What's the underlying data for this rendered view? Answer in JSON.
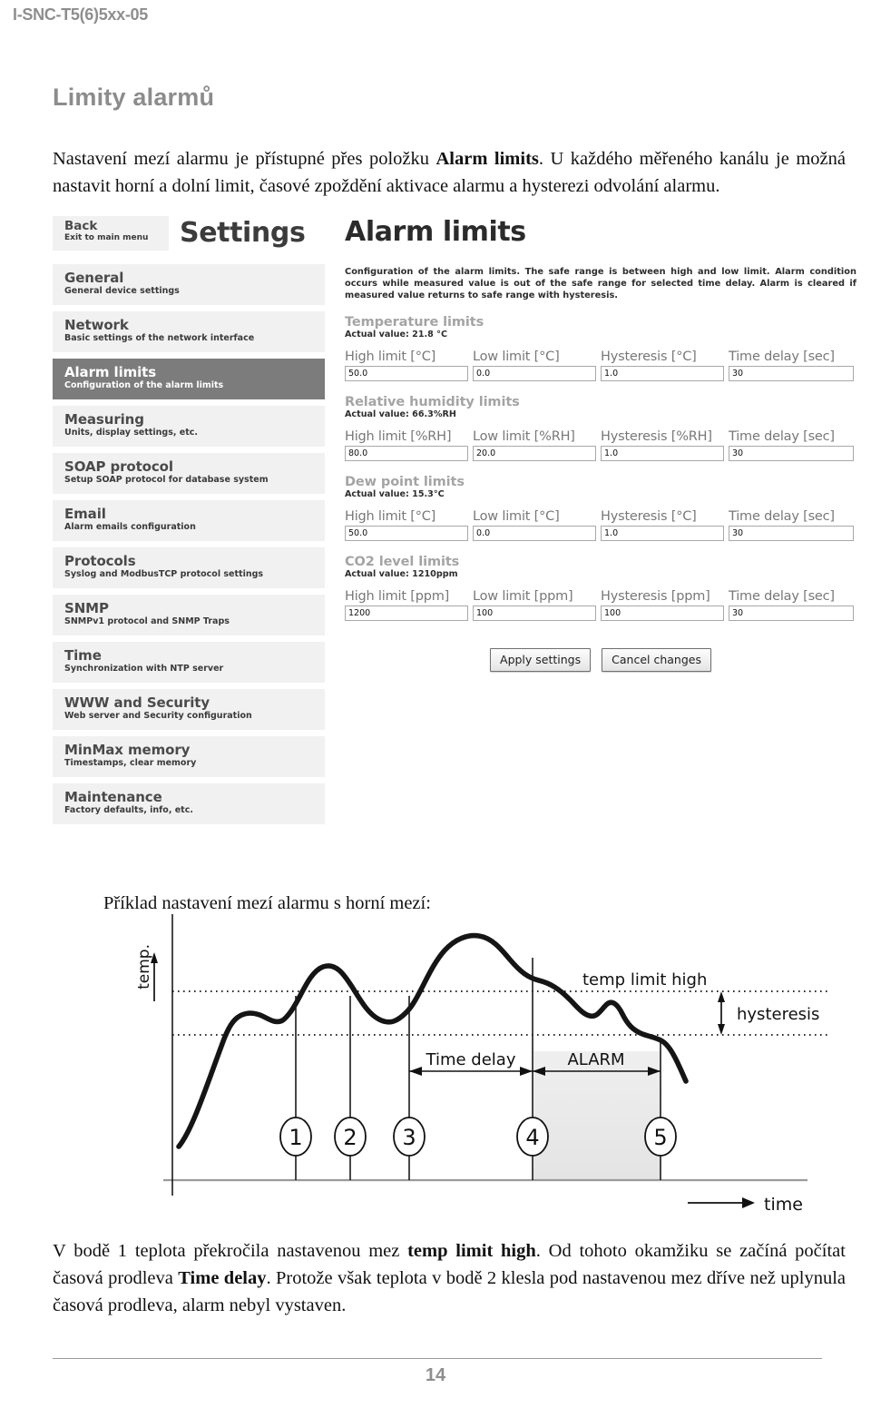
{
  "doc": {
    "running_header": "I-SNC-T5(6)5xx-05",
    "page_number": "14",
    "section_title": "Limity alarmů",
    "intro_para_1": "Nastavení mezí alarmu je přístupné přes položku ",
    "intro_bold_1": "Alarm limits",
    "intro_para_2": ". U každého měřeného kanálu je možná nastavit horní a dolní limit, časové zpoždění aktivace alarmu a hysterezi odvolání alarmu.",
    "example_caption": "Příklad nastavení mezí alarmu s horní mezí:",
    "closing_1": "V bodě 1 teplota překročila nastavenou mez ",
    "closing_bold_1": "temp limit high",
    "closing_2": ". Od tohoto okamžiku se začíná počítat časová prodleva ",
    "closing_bold_2": "Time delay",
    "closing_3": ". Protože však teplota v bodě 2 klesla pod nastavenou mez dříve než uplynula časová prodleva, alarm nebyl vystaven."
  },
  "screenshot": {
    "back": {
      "title": "Back",
      "subtitle": "Exit to main menu"
    },
    "settings_heading": "Settings",
    "page_heading": "Alarm limits",
    "description": "Configuration of the alarm limits. The safe range is between high and low limit. Alarm condition occurs while measured value is out of the safe range for selected time delay. Alarm is cleared if measured value returns to safe range with hysteresis.",
    "nav": [
      {
        "title": "General",
        "subtitle": "General device settings",
        "active": false
      },
      {
        "title": "Network",
        "subtitle": "Basic settings of the network interface",
        "active": false
      },
      {
        "title": "Alarm limits",
        "subtitle": "Configuration of the alarm limits",
        "active": true
      },
      {
        "title": "Measuring",
        "subtitle": "Units, display settings, etc.",
        "active": false
      },
      {
        "title": "SOAP protocol",
        "subtitle": "Setup SOAP protocol for database system",
        "active": false
      },
      {
        "title": "Email",
        "subtitle": "Alarm emails configuration",
        "active": false
      },
      {
        "title": "Protocols",
        "subtitle": "Syslog and ModbusTCP protocol settings",
        "active": false
      },
      {
        "title": "SNMP",
        "subtitle": "SNMPv1 protocol and SNMP Traps",
        "active": false
      },
      {
        "title": "Time",
        "subtitle": "Synchronization with NTP server",
        "active": false
      },
      {
        "title": "WWW and Security",
        "subtitle": "Web server and Security configuration",
        "active": false
      },
      {
        "title": "MinMax memory",
        "subtitle": "Timestamps, clear memory",
        "active": false
      },
      {
        "title": "Maintenance",
        "subtitle": "Factory defaults, info, etc.",
        "active": false
      }
    ],
    "groups": [
      {
        "title": "Temperature limits",
        "actual": "Actual value: 21.8 °C",
        "labels": [
          "High limit [°C]",
          "Low limit [°C]",
          "Hysteresis [°C]",
          "Time delay [sec]"
        ],
        "values": [
          "50.0",
          "0.0",
          "1.0",
          "30"
        ]
      },
      {
        "title": "Relative humidity limits",
        "actual": "Actual value: 66.3%RH",
        "labels": [
          "High limit [%RH]",
          "Low limit [%RH]",
          "Hysteresis [%RH]",
          "Time delay [sec]"
        ],
        "values": [
          "80.0",
          "20.0",
          "1.0",
          "30"
        ]
      },
      {
        "title": "Dew point limits",
        "actual": "Actual value: 15.3°C",
        "labels": [
          "High limit [°C]",
          "Low limit [°C]",
          "Hysteresis [°C]",
          "Time delay [sec]"
        ],
        "values": [
          "50.0",
          "0.0",
          "1.0",
          "30"
        ]
      },
      {
        "title": "CO2 level limits",
        "actual": "Actual value: 1210ppm",
        "labels": [
          "High limit [ppm]",
          "Low limit [ppm]",
          "Hysteresis [ppm]",
          "Time delay [sec]"
        ],
        "values": [
          "1200",
          "100",
          "100",
          "30"
        ]
      }
    ],
    "buttons": {
      "apply": "Apply settings",
      "cancel": "Cancel changes"
    }
  },
  "chart_data": {
    "type": "line",
    "title": "",
    "xlabel": "time",
    "ylabel": "temp.",
    "grid": false,
    "legend": null,
    "annotations": {
      "limit_high_label": "temp limit high",
      "hysteresis_label": "hysteresis",
      "time_delay_label": "Time delay",
      "alarm_label": "ALARM"
    },
    "markers": [
      "1",
      "2",
      "3",
      "4",
      "5"
    ],
    "marker_meaning": [
      "curve rises above temp limit high (time delay starts)",
      "curve falls back below temp limit high before delay elapses",
      "curve rises above temp limit high again (time delay restarts)",
      "time delay elapsed - ALARM is raised",
      "curve falls below hysteresis line - ALARM is cleared"
    ],
    "levels": {
      "temp_limit_high": 1.0,
      "hysteresis_line": 0.72
    },
    "series": [
      {
        "name": "temp.",
        "x": [
          0.0,
          0.05,
          0.1,
          0.14,
          0.18,
          0.22,
          0.26,
          0.3,
          0.34,
          0.38,
          0.42,
          0.46,
          0.5,
          0.55,
          0.6,
          0.65,
          0.7,
          0.74,
          0.78,
          0.82,
          0.86,
          0.9,
          0.94,
          0.98
        ],
        "y": [
          0.18,
          0.46,
          0.72,
          0.8,
          0.79,
          0.77,
          0.8,
          0.95,
          1.1,
          1.12,
          1.05,
          0.98,
          0.92,
          0.88,
          0.95,
          1.2,
          1.42,
          1.45,
          1.33,
          1.18,
          1.02,
          0.88,
          0.95,
          0.62
        ]
      }
    ]
  }
}
